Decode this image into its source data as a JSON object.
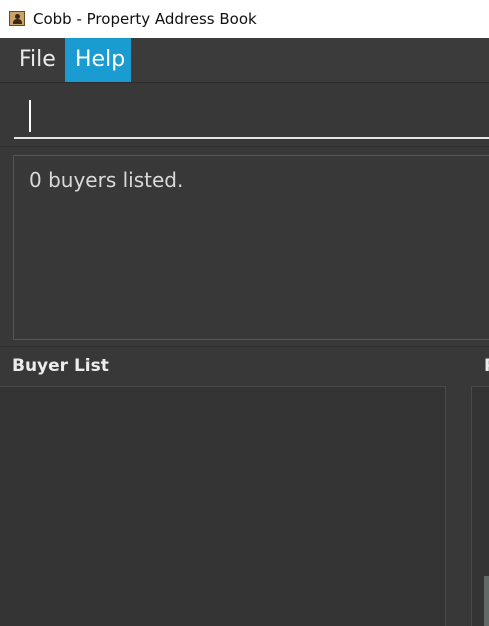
{
  "window": {
    "title": "Cobb - Property Address Book",
    "icon": "address-book-icon"
  },
  "menu": {
    "items": [
      {
        "label": "File",
        "active": false
      },
      {
        "label": "Help",
        "active": true
      }
    ],
    "active_color": "#1a9bd2"
  },
  "command": {
    "value": ""
  },
  "result": {
    "text": "0 buyers listed."
  },
  "panels": {
    "buyer": {
      "title": "Buyer List"
    },
    "property": {
      "title": "P"
    }
  },
  "colors": {
    "background": "#383838",
    "menubar": "#3b3b3b",
    "text": "#ececec"
  }
}
